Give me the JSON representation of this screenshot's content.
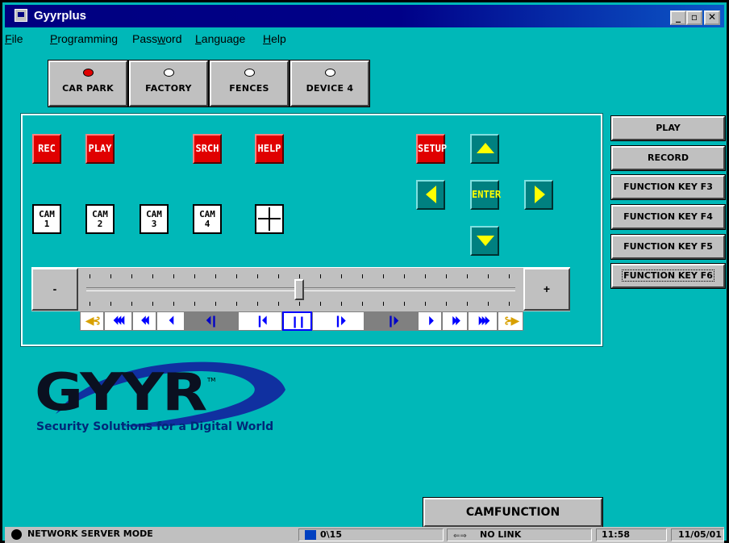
{
  "window": {
    "title": "Gyyrplus",
    "controls": {
      "minimize": "_",
      "restore": "▫",
      "close": "✕"
    }
  },
  "menu": [
    {
      "label": "File",
      "u": "F",
      "rest": "ile"
    },
    {
      "label": "Programming",
      "u": "P",
      "rest": "rogramming"
    },
    {
      "label": "Password",
      "pre": "Pass",
      "u": "w",
      "rest": "ord"
    },
    {
      "label": "Language",
      "u": "L",
      "rest": "anguage"
    },
    {
      "label": "Help",
      "u": "H",
      "rest": "elp"
    }
  ],
  "sites": [
    {
      "label": "CAR PARK",
      "active": true
    },
    {
      "label": "FACTORY",
      "active": false
    },
    {
      "label": "FENCES",
      "active": false
    },
    {
      "label": "DEVICE 4",
      "active": false
    }
  ],
  "controls": {
    "rec": "REC",
    "play": "PLAY",
    "srch": "SRCH",
    "help": "HELP",
    "setup": "SETUP",
    "enter": "ENTER",
    "cams": [
      {
        "l1": "CAM",
        "l2": "1"
      },
      {
        "l1": "CAM",
        "l2": "2"
      },
      {
        "l1": "CAM",
        "l2": "3"
      },
      {
        "l1": "CAM",
        "l2": "4"
      }
    ]
  },
  "slider": {
    "minus": "-",
    "plus": "+",
    "position_fraction": 0.5
  },
  "transport": [
    "⏴⏴⏴",
    "⏴⏴",
    "⏴",
    "⏴❙",
    "❙⏴",
    "❙❙",
    "❙⏵",
    "❙⏵",
    "⏵",
    "⏵⏵",
    "⏵⏵⏵"
  ],
  "side_buttons": [
    "PLAY",
    "RECORD",
    "FUNCTION KEY F3",
    "FUNCTION KEY F4",
    "FUNCTION KEY F5",
    "FUNCTION KEY F6"
  ],
  "logo": {
    "text": "GYYR",
    "tm": "TM",
    "tagline": "Security Solutions for a Digital World"
  },
  "camfunction": "CAMFUNCTION",
  "status": {
    "mode": "NETWORK SERVER MODE",
    "count": "0\\15",
    "link": "NO LINK",
    "time": "11:58",
    "date": "11/05/01"
  },
  "colors": {
    "background": "#00b8b8",
    "title": "#000080",
    "red_button": "#e00000",
    "nav_button": "#008080",
    "arrow": "#ffff00",
    "logo_blue": "#1030a0"
  }
}
